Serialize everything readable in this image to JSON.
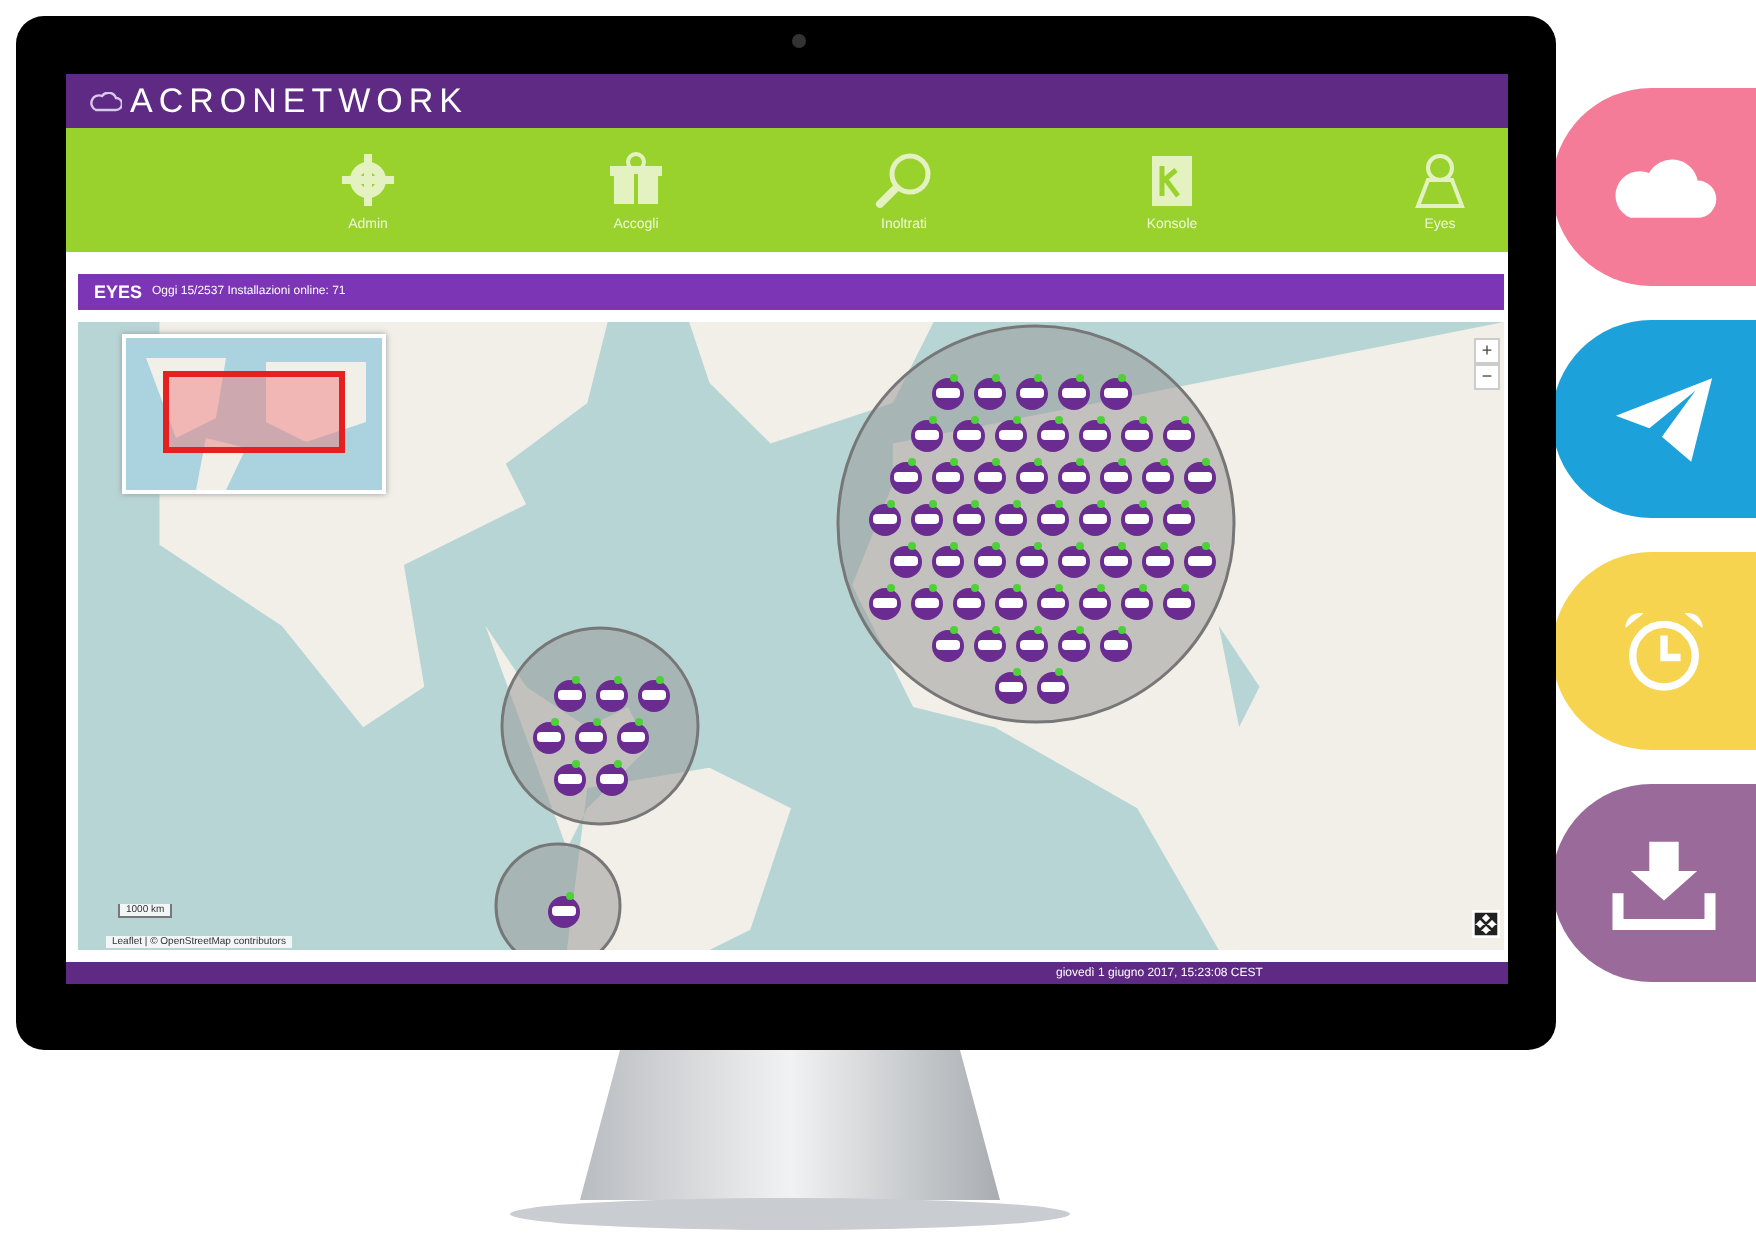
{
  "app": {
    "title": "ACRONETWORK"
  },
  "nav": [
    {
      "label": "Admin"
    },
    {
      "label": "Accogli"
    },
    {
      "label": "Inoltrati"
    },
    {
      "label": "Konsole"
    },
    {
      "label": "Eyes"
    }
  ],
  "panel": {
    "title": "EYES",
    "summary": "Oggi 15/2537 Installazioni online: 71"
  },
  "map": {
    "kind": "picture",
    "zoom_in": "+",
    "zoom_out": "−",
    "scale": "1000 km",
    "attribution": "Leaflet | © OpenStreetMap contributors"
  },
  "status_bar": {
    "datetime": "giovedì 1 giugno 2017, 15:23:08 CEST"
  },
  "side_buttons": [
    {
      "color": "#f47c99"
    },
    {
      "color": "#1da1db"
    },
    {
      "color": "#f6d44f"
    },
    {
      "color": "#9a6a9a"
    }
  ]
}
